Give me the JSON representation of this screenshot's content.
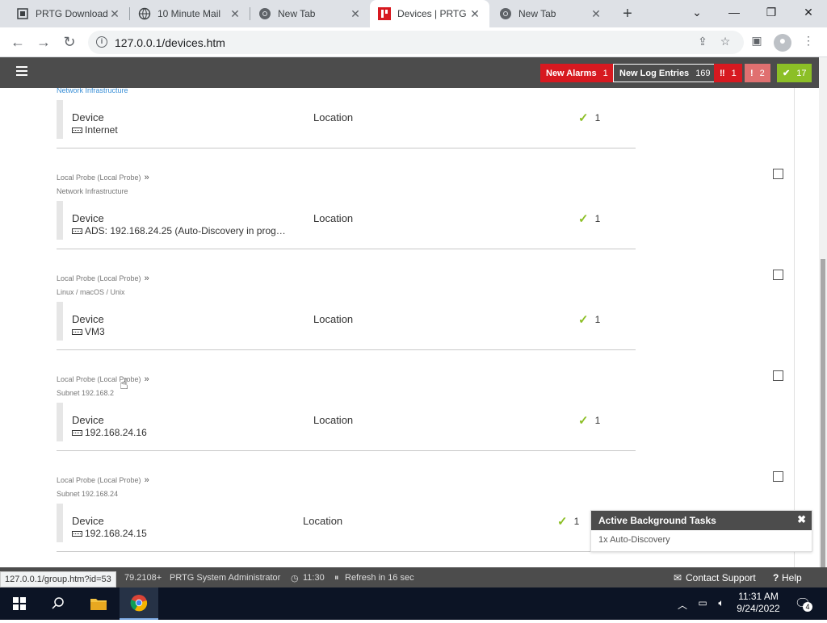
{
  "browser": {
    "tabs": [
      {
        "title": "PRTG Download",
        "icon": "prtg-doc-icon"
      },
      {
        "title": "10 Minute Mail",
        "icon": "globe-icon"
      },
      {
        "title": "New Tab",
        "icon": "chrome-icon"
      },
      {
        "title": "Devices | PRTG N",
        "icon": "prtg-icon",
        "active": true
      },
      {
        "title": "New Tab",
        "icon": "chrome-icon"
      }
    ],
    "url": "127.0.0.1/devices.htm",
    "status_url": "127.0.0.1/group.htm?id=53"
  },
  "header": {
    "new_alarms_label": "New Alarms",
    "new_alarms_count": "1",
    "new_log_label": "New Log Entries",
    "new_log_count": "169",
    "down_count": "1",
    "warning_count": "2",
    "up_count": "17"
  },
  "devices": [
    {
      "probe": "",
      "group": "Network Infrastructure",
      "device_label": "Device",
      "device_name": "Internet",
      "location_label": "Location",
      "up_count": "1"
    },
    {
      "probe": "Local Probe (Local Probe)",
      "group": "Network Infrastructure",
      "device_label": "Device",
      "device_name": "ADS: 192.168.24.25 (Auto-Discovery in prog…",
      "location_label": "Location",
      "up_count": "1"
    },
    {
      "probe": "Local Probe (Local Probe)",
      "group": "Linux / macOS / Unix",
      "device_label": "Device",
      "device_name": "VM3",
      "location_label": "Location",
      "up_count": "1"
    },
    {
      "probe": "Local Probe (Local Probe)",
      "group": "Subnet 192.168.2",
      "device_label": "Device",
      "device_name": "192.168.24.16",
      "location_label": "Location",
      "up_count": "1"
    },
    {
      "probe": "Local Probe (Local Probe)",
      "group": "Subnet 192.168.24",
      "device_label": "Device",
      "device_name": "192.168.24.15",
      "location_label": "Location",
      "up_count": "1"
    }
  ],
  "background_tasks": {
    "title": "Active Background Tasks",
    "item": "1x Auto-Discovery"
  },
  "footer": {
    "version": "79.2108+",
    "user": "PRTG System Administrator",
    "time": "11:30",
    "refresh": "Refresh in 16 sec",
    "contact": "Contact Support",
    "help": "Help"
  },
  "taskbar": {
    "time": "11:31 AM",
    "date": "9/24/2022",
    "notifications": "4"
  },
  "colors": {
    "prtg_header": "#4c4c4c",
    "alarm_red": "#d71920",
    "warning_pink": "#e07070",
    "up_green": "#8cbf26",
    "link_blue": "#3a8fd6"
  }
}
